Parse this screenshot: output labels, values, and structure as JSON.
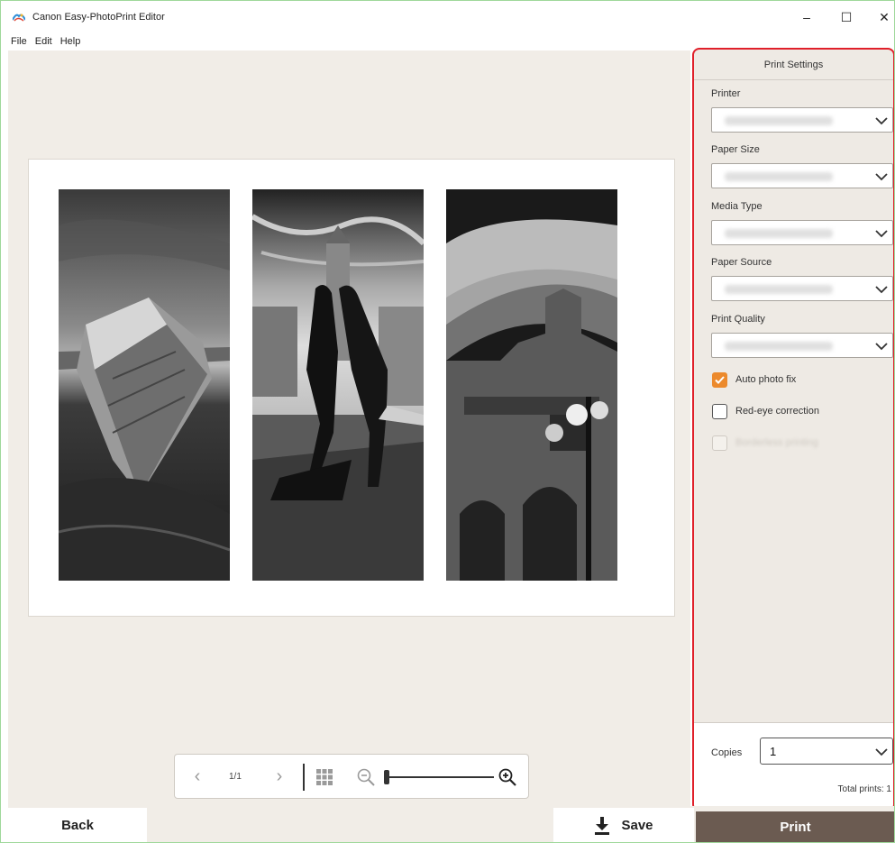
{
  "window": {
    "title": "Canon Easy-PhotoPrint Editor",
    "minimize_glyph": "–",
    "maximize_glyph": "☐",
    "close_glyph": "✕"
  },
  "menu": {
    "items": [
      {
        "label": "File"
      },
      {
        "label": "Edit"
      },
      {
        "label": "Help"
      }
    ]
  },
  "canvas": {
    "photos": [
      {
        "icon": "boat-photo"
      },
      {
        "icon": "dancers-photo"
      },
      {
        "icon": "cathedral-photo"
      }
    ]
  },
  "navigation": {
    "prev_glyph": "‹",
    "next_glyph": "›",
    "page_indicator": "1/1",
    "zoom_level": 0
  },
  "print_settings": {
    "title": "Print Settings",
    "fields": [
      {
        "label": "Printer",
        "value": ""
      },
      {
        "label": "Paper Size",
        "value": ""
      },
      {
        "label": "Media Type",
        "value": ""
      },
      {
        "label": "Paper Source",
        "value": ""
      },
      {
        "label": "Print Quality",
        "value": ""
      }
    ],
    "options": [
      {
        "label": "Auto photo fix",
        "checked": true,
        "enabled": true
      },
      {
        "label": "Red-eye correction",
        "checked": false,
        "enabled": true
      },
      {
        "label": "Borderless printing",
        "checked": false,
        "enabled": false
      }
    ],
    "copies_label": "Copies",
    "copies_value": "1",
    "total_prints": "Total prints: 1"
  },
  "buttons": {
    "back": "Back",
    "save": "Save",
    "print": "Print"
  },
  "colors": {
    "accent_orange": "#ec8a2c",
    "highlight_red": "#e0202a",
    "print_button": "#6b5b51",
    "canvas_bg": "#f1ede7"
  }
}
